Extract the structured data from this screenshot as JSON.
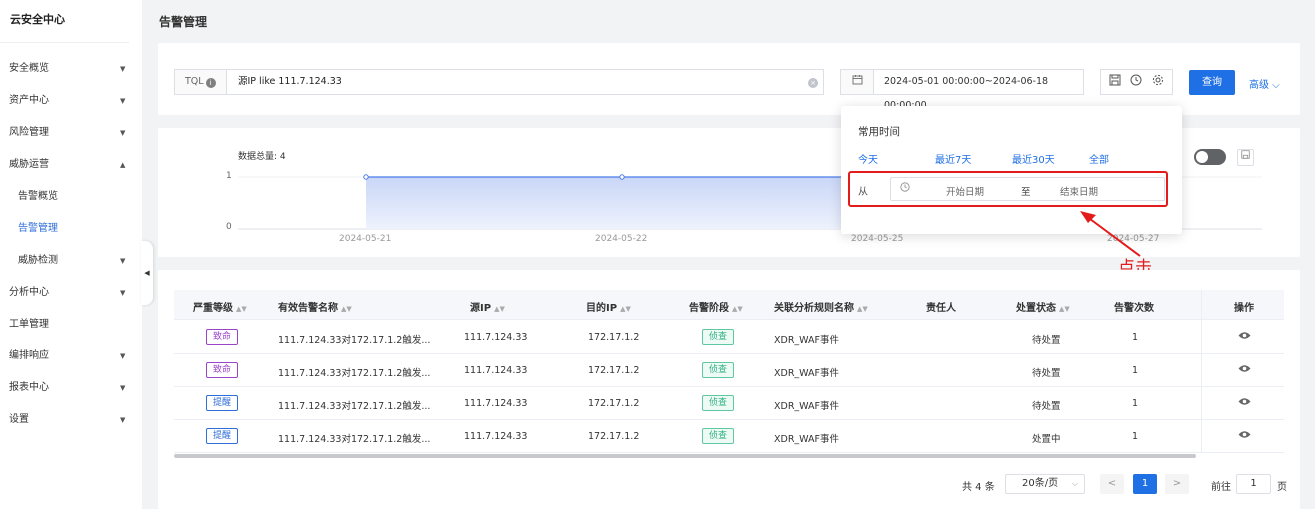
{
  "sidebar": {
    "brand": "云安全中心",
    "items": [
      {
        "label": "安全概览",
        "chevron": "▼"
      },
      {
        "label": "资产中心",
        "chevron": "▼"
      },
      {
        "label": "风险管理",
        "chevron": "▼"
      },
      {
        "label": "威胁运营",
        "chevron": "▲"
      },
      {
        "label": "告警概览",
        "chevron": ""
      },
      {
        "label": "告警管理",
        "chevron": ""
      },
      {
        "label": "威胁检测",
        "chevron": "▼"
      },
      {
        "label": "分析中心",
        "chevron": "▼"
      },
      {
        "label": "工单管理",
        "chevron": ""
      },
      {
        "label": "编排响应",
        "chevron": "▼"
      },
      {
        "label": "报表中心",
        "chevron": "▼"
      },
      {
        "label": "设置",
        "chevron": "▼"
      }
    ]
  },
  "page": {
    "title": "告警管理"
  },
  "filter": {
    "tql_label": "TQL",
    "info": "i",
    "query": "源IP like 111.7.124.33",
    "clear": "×",
    "date_range": "2024-05-01 00:00:00~2024-06-18 00:00:00",
    "query_button": "查询",
    "advanced": "高级 ⌵"
  },
  "chart": {
    "total_label": "数据总量: 4",
    "chart_data": {
      "type": "area",
      "x": [
        "2024-05-21",
        "2024-05-22",
        "2024-05-25",
        "2024-05-27"
      ],
      "values": [
        1,
        1,
        1,
        1
      ],
      "yticks": [
        0,
        1
      ],
      "ylim": [
        0,
        1
      ]
    }
  },
  "popup": {
    "title": "常用时间",
    "quick": [
      "今天",
      "最近7天",
      "最近30天",
      "全部"
    ],
    "from": "从",
    "start_placeholder": "开始日期",
    "to": "至",
    "end_placeholder": "结束日期"
  },
  "annotation": {
    "text": "点击",
    "color": "#e31b1b"
  },
  "table": {
    "columns": [
      "严重等级",
      "有效告警名称",
      "源IP",
      "目的IP",
      "告警阶段",
      "关联分析规则名称",
      "责任人",
      "处置状态",
      "告警次数",
      "操作"
    ],
    "rows": [
      {
        "severity": "致命",
        "name": "111.7.124.33对172.17.1.2触发...",
        "src": "111.7.124.33",
        "dst": "172.17.1.2",
        "stage": "侦查",
        "rule": "XDR_WAF事件",
        "owner": "",
        "status": "待处置",
        "count": "1"
      },
      {
        "severity": "致命",
        "name": "111.7.124.33对172.17.1.2触发...",
        "src": "111.7.124.33",
        "dst": "172.17.1.2",
        "stage": "侦查",
        "rule": "XDR_WAF事件",
        "owner": "",
        "status": "待处置",
        "count": "1"
      },
      {
        "severity": "提醒",
        "name": "111.7.124.33对172.17.1.2触发...",
        "src": "111.7.124.33",
        "dst": "172.17.1.2",
        "stage": "侦查",
        "rule": "XDR_WAF事件",
        "owner": "",
        "status": "待处置",
        "count": "1"
      },
      {
        "severity": "提醒",
        "name": "111.7.124.33对172.17.1.2触发...",
        "src": "111.7.124.33",
        "dst": "172.17.1.2",
        "stage": "侦查",
        "rule": "XDR_WAF事件",
        "owner": "",
        "status": "处置中",
        "count": "1"
      }
    ]
  },
  "severity_colors": {
    "致命": "#9b44c9",
    "提醒": "#2f6ed8"
  },
  "pagination": {
    "total": "共 4 条",
    "page_size": "20条/页",
    "prev": "<",
    "current": "1",
    "next": ">",
    "goto_label": "前往",
    "goto_value": "1",
    "page_label": "页"
  }
}
